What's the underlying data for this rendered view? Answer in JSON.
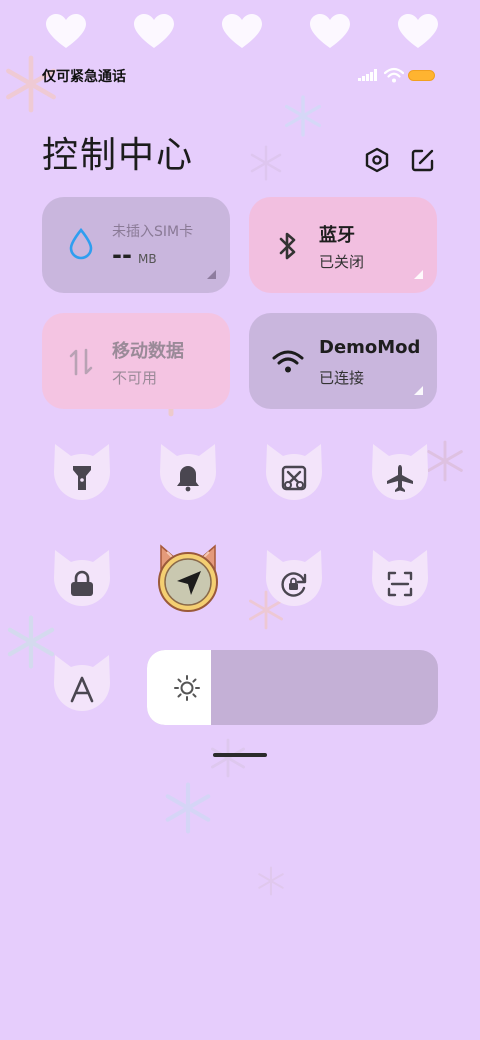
{
  "status_bar": {
    "carrier_text": "仅可紧急通话",
    "signal_icon": "signal-icon",
    "wifi_icon": "wifi-icon",
    "battery_icon": "battery-icon",
    "battery_color": "#ffb430"
  },
  "header": {
    "title": "控制中心",
    "settings_icon": "settings-hexagon-icon",
    "edit_icon": "edit-icon"
  },
  "tiles": {
    "data_usage": {
      "label": "未插入SIM卡",
      "value": "--",
      "unit": "MB",
      "icon": "water-drop-icon",
      "color": "#c9b6dd"
    },
    "bluetooth": {
      "label": "蓝牙",
      "status": "已关闭",
      "icon": "bluetooth-icon",
      "color": "#f2bfe0"
    },
    "mobile_data": {
      "label": "移动数据",
      "status": "不可用",
      "icon": "mobile-data-arrows-icon",
      "color": "#f4c4e2"
    },
    "wifi": {
      "label": "DemoMode",
      "status": "已连接",
      "icon": "wifi-icon",
      "color": "#c9b6dd"
    }
  },
  "toggles": [
    {
      "icon": "flashlight-icon",
      "active": false
    },
    {
      "icon": "bell-icon",
      "active": false
    },
    {
      "icon": "screenshot-scissors-icon",
      "active": false
    },
    {
      "icon": "airplane-icon",
      "active": false
    },
    {
      "icon": "lock-icon",
      "active": false
    },
    {
      "icon": "location-arrow-icon",
      "active": true
    },
    {
      "icon": "rotation-lock-icon",
      "active": false
    },
    {
      "icon": "scan-icon",
      "active": false
    },
    {
      "icon": "font-a-icon",
      "active": false
    }
  ],
  "brightness": {
    "icon": "sun-icon",
    "level": 0.22
  },
  "colors": {
    "background": "#e6cdfc",
    "toggle_active": "#f0a080",
    "brightness_track": "#c4b0d6"
  }
}
